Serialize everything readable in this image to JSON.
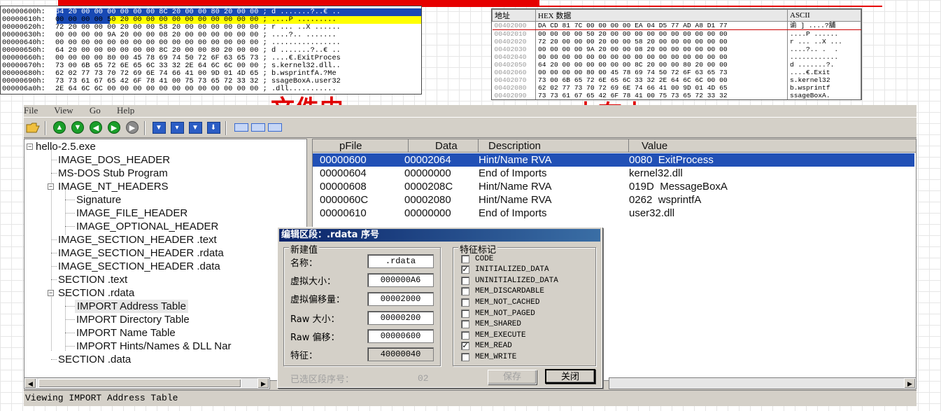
{
  "captions": {
    "file": "文件中",
    "memory": "内存中"
  },
  "hex_file": {
    "rows": [
      {
        "addr": "00000600h:",
        "hex": "64 20 00 00 00 00 00 00 8C 20 00 00 80 20 00 00",
        "ascii": "; d .......?..€ .."
      },
      {
        "addr": "00000610h:",
        "hex": "00 00 00 00 50 20 00 00 00 00 00 00 00 00 00 00",
        "ascii": "; ....P ........."
      },
      {
        "addr": "00000620h:",
        "hex": "72 20 00 00 00 20 00 00 58 20 00 00 00 00 00 00",
        "ascii": "; r ... ..X ......"
      },
      {
        "addr": "00000630h:",
        "hex": "00 00 00 00 9A 20 00 00 08 20 00 00 00 00 00 00",
        "ascii": "; ....?.. .......  "
      },
      {
        "addr": "00000640h:",
        "hex": "00 00 00 00 00 00 00 00 00 00 00 00 00 00 00 00",
        "ascii": "; ................"
      },
      {
        "addr": "00000650h:",
        "hex": "64 20 00 00 00 00 00 00 8C 20 00 00 80 20 00 00",
        "ascii": "; d .......?..€ .."
      },
      {
        "addr": "00000660h:",
        "hex": "00 00 00 00 80 00 45 78 69 74 50 72 6F 63 65 73",
        "ascii": "; ....€.ExitProces"
      },
      {
        "addr": "00000670h:",
        "hex": "73 00 6B 65 72 6E 65 6C 33 32 2E 64 6C 6C 00 00",
        "ascii": "; s.kernel32.dll.."
      },
      {
        "addr": "00000680h:",
        "hex": "62 02 77 73 70 72 69 6E 74 66 41 00 9D 01 4D 65",
        "ascii": "; b.wsprintfA.?Me"
      },
      {
        "addr": "00000690h:",
        "hex": "73 73 61 67 65 42 6F 78 41 00 75 73 65 72 33 32",
        "ascii": "; ssageBoxA.user32"
      },
      {
        "addr": "000006a0h:",
        "hex": "2E 64 6C 6C 00 00 00 00 00 00 00 00 00 00 00 00",
        "ascii": "; .dll..........."
      }
    ]
  },
  "hex_memory": {
    "headers": [
      "地址",
      "HEX 数据",
      "ASCII"
    ],
    "rows": [
      {
        "addr": "00402000",
        "hex": "DA CD 81 7C 00 00 00 00 EA 04 D5 77 AD A8 D1 77",
        "ascii": "谕 ] ....?舖"
      },
      {
        "addr": "00402010",
        "hex": "00 00 00 00 50 20 00 00 00 00 00 00 00 00 00 00",
        "ascii": "....P ......"
      },
      {
        "addr": "00402020",
        "hex": "72 20 00 00 00 20 00 00 58 20 00 00 00 00 00 00",
        "ascii": "r ... ..X ..."
      },
      {
        "addr": "00402030",
        "hex": "00 00 00 00 9A 20 00 00 08 20 00 00 00 00 00 00",
        "ascii": "....?.. .  ."
      },
      {
        "addr": "00402040",
        "hex": "00 00 00 00 00 00 00 00 00 00 00 00 00 00 00 00",
        "ascii": "............"
      },
      {
        "addr": "00402050",
        "hex": "64 20 00 00 00 00 00 00 8C 20 00 00 80 20 00 00",
        "ascii": "d .......?."
      },
      {
        "addr": "00402060",
        "hex": "00 00 00 00 80 00 45 78 69 74 50 72 6F 63 65 73",
        "ascii": "....€.Exit"
      },
      {
        "addr": "00402070",
        "hex": "73 00 6B 65 72 6E 65 6C 33 32 2E 64 6C 6C 00 00",
        "ascii": "s.kernel32"
      },
      {
        "addr": "00402080",
        "hex": "62 02 77 73 70 72 69 6E 74 66 41 00 9D 01 4D 65",
        "ascii": "b.wsprintf"
      },
      {
        "addr": "00402090",
        "hex": "73 73 61 67 65 42 6F 78 41 00 75 73 65 72 33 32",
        "ascii": "ssageBoxA."
      }
    ]
  },
  "menu": [
    "File",
    "View",
    "Go",
    "Help"
  ],
  "tree": {
    "items": [
      {
        "label": "hello-2.5.exe"
      },
      {
        "label": "IMAGE_DOS_HEADER"
      },
      {
        "label": "MS-DOS Stub Program"
      },
      {
        "label": "IMAGE_NT_HEADERS"
      },
      {
        "label": "Signature"
      },
      {
        "label": "IMAGE_FILE_HEADER"
      },
      {
        "label": "IMAGE_OPTIONAL_HEADER"
      },
      {
        "label": "IMAGE_SECTION_HEADER .text"
      },
      {
        "label": "IMAGE_SECTION_HEADER .rdata"
      },
      {
        "label": "IMAGE_SECTION_HEADER .data"
      },
      {
        "label": "SECTION .text"
      },
      {
        "label": "SECTION .rdata"
      },
      {
        "label": "IMPORT Address Table"
      },
      {
        "label": "IMPORT Directory Table"
      },
      {
        "label": "IMPORT Name Table"
      },
      {
        "label": "IMPORT Hints/Names & DLL Nar"
      },
      {
        "label": "SECTION .data"
      }
    ]
  },
  "list": {
    "headers": [
      "pFile",
      "Data",
      "Description",
      "Value"
    ],
    "rows": [
      {
        "pfile": "00000600",
        "data": "00002064",
        "desc": "Hint/Name RVA",
        "value": "0080  ExitProcess"
      },
      {
        "pfile": "00000604",
        "data": "00000000",
        "desc": "End of Imports",
        "value": "kernel32.dll"
      },
      {
        "pfile": "00000608",
        "data": "0000208C",
        "desc": "Hint/Name RVA",
        "value": "019D  MessageBoxA"
      },
      {
        "pfile": "0000060C",
        "data": "00002080",
        "desc": "Hint/Name RVA",
        "value": "0262  wsprintfA"
      },
      {
        "pfile": "00000610",
        "data": "00000000",
        "desc": "End of Imports",
        "value": "user32.dll"
      }
    ]
  },
  "dialog": {
    "title": "编辑区段：.rdata  序号",
    "new_values_label": "新建值",
    "flags_label": "特征标记",
    "fields": [
      {
        "label": "名称：",
        "value": ".rdata"
      },
      {
        "label": "虚拟大小：",
        "value": "000000A6"
      },
      {
        "label": "虚拟偏移量：",
        "value": "00002000"
      },
      {
        "label": "Raw 大小：",
        "value": "00000200"
      },
      {
        "label": "Raw 偏移：",
        "value": "00000600"
      },
      {
        "label": "特征：",
        "value": "40000040"
      }
    ],
    "flags": [
      {
        "label": "CODE",
        "checked": ""
      },
      {
        "label": "INITIALIZED_DATA",
        "checked": "✓"
      },
      {
        "label": "UNINITIALIZED_DATA",
        "checked": ""
      },
      {
        "label": "MEM_DISCARDABLE",
        "checked": ""
      },
      {
        "label": "MEM_NOT_CACHED",
        "checked": ""
      },
      {
        "label": "MEM_NOT_PAGED",
        "checked": ""
      },
      {
        "label": "MEM_SHARED",
        "checked": ""
      },
      {
        "label": "MEM_EXECUTE",
        "checked": ""
      },
      {
        "label": "MEM_READ",
        "checked": "✓"
      },
      {
        "label": "MEM_WRITE",
        "checked": ""
      }
    ],
    "selected_section_label": "已选区段序号：",
    "selected_section_value": "02",
    "save_label": "保存",
    "close_label": "关闭"
  },
  "status": "Viewing IMPORT Address Table",
  "colors": {
    "accent_red": "#e60000",
    "selection_blue": "#2150b6",
    "caption_red": "#e00000"
  }
}
